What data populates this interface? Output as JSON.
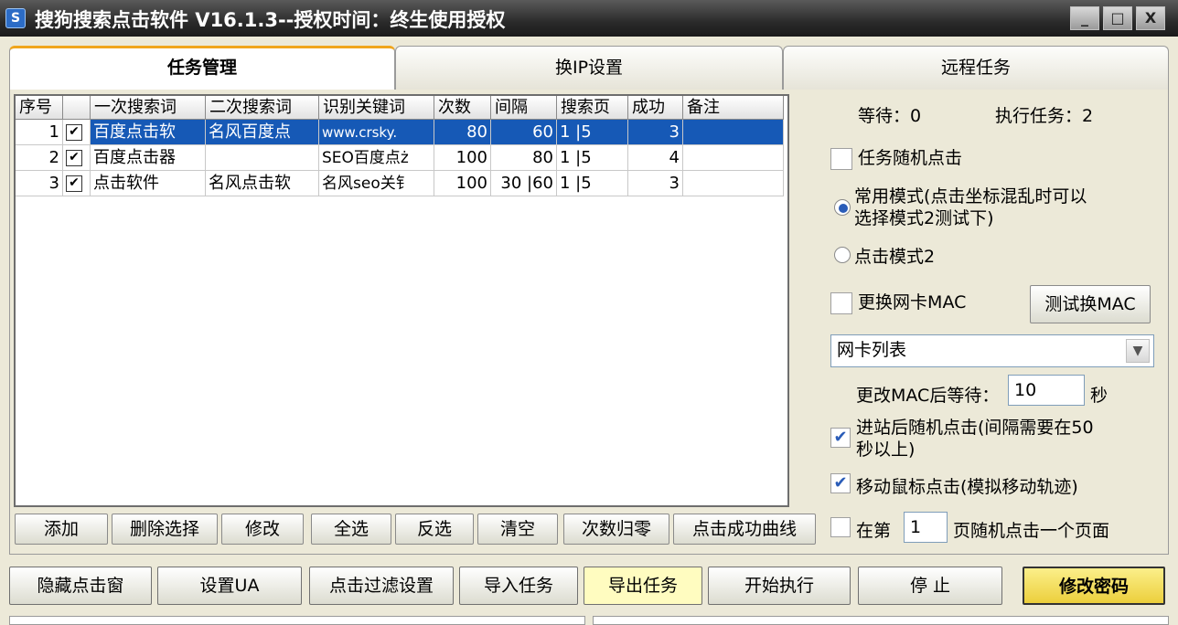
{
  "window": {
    "title": "搜狗搜索点击软件 V16.1.3--授权时间：终生使用授权",
    "app_icon": "S",
    "controls": [
      "_",
      "□",
      "X"
    ]
  },
  "tabs": [
    "任务管理",
    "换IP设置",
    "远程任务"
  ],
  "grid": {
    "headers": [
      "序号",
      "",
      "一次搜索词",
      "二次搜索词",
      "识别关键词",
      "次数",
      "间隔",
      "搜索页",
      "成功",
      "备注"
    ],
    "rows": [
      {
        "no": "1",
        "check": "✔",
        "kw1": "百度点击软",
        "kw2": "名风百度点",
        "match": "www.crsky.",
        "count": "80",
        "interval": "60",
        "page": "1 |5",
        "success": "3",
        "note": ""
      },
      {
        "no": "2",
        "check": "✔",
        "kw1": "百度点击器",
        "kw2": "",
        "match": "SEO百度点ż",
        "count": "100",
        "interval": "80",
        "page": "1 |5",
        "success": "4",
        "note": ""
      },
      {
        "no": "3",
        "check": "✔",
        "kw1": "点击软件",
        "kw2": "名风点击软",
        "match": "名风seo关钅",
        "count": "100",
        "interval": "30 |60",
        "page": "1 |5",
        "success": "3",
        "note": ""
      }
    ]
  },
  "grid_buttons": [
    "添加",
    "删除选择",
    "修改",
    "全选",
    "反选",
    "清空",
    "次数归零",
    "点击成功曲线"
  ],
  "right_panel": {
    "wait_label": "等待：0",
    "tasks_label": "执行任务：2",
    "random_click_label": "任务随机点击",
    "mode1_label_line1": "常用模式(点击坐标混乱时可以",
    "mode1_label_line2": "选择模式2测试下)",
    "mode2_label": "点击模式2",
    "mac_label": "更换网卡MAC",
    "mac_test_button": "测试换MAC",
    "nic_select": "网卡列表",
    "mac_wait_label": "更改MAC后等待：",
    "mac_wait_value": "10",
    "mac_wait_unit": "秒",
    "enter_random_line1": "进站后随机点击(间隔需要在50",
    "enter_random_line2": "秒以上)",
    "mouse_move_label": "移动鼠标点击(模拟移动轨迹)",
    "page_prefix": "在第",
    "page_value": "1",
    "page_suffix": "页随机点击一个页面"
  },
  "bottom_buttons": [
    "隐藏点击窗",
    "设置UA",
    "点击过滤设置",
    "导入任务",
    "导出任务",
    "开始执行",
    "停 止",
    "修改密码"
  ],
  "colors": {
    "selected_row": "#1659b6",
    "highlight_button": "#fffcc0",
    "password_button": "#f6e26a"
  }
}
